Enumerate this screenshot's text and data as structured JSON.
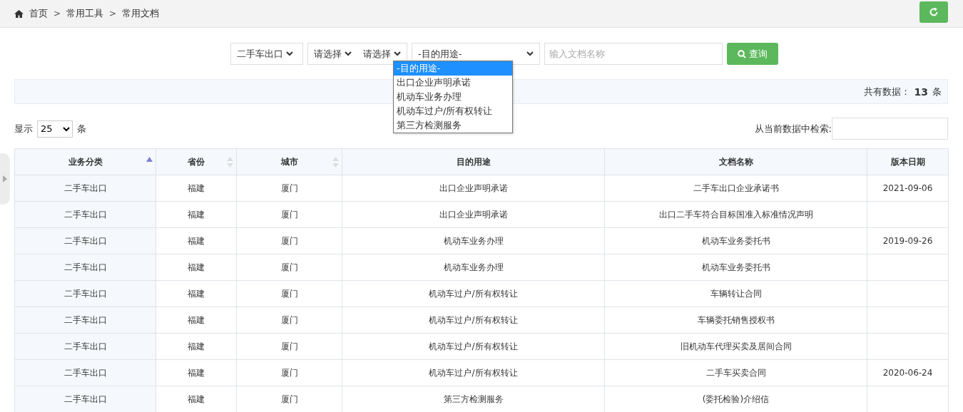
{
  "breadcrumb": [
    "首页",
    "常用工具",
    "常用文档"
  ],
  "breadcrumb_separator": ">",
  "filters": {
    "category": "二手车出口",
    "province": "请选择",
    "city": "请选择",
    "purpose": "-目的用途-",
    "name_placeholder": "输入文档名称",
    "search_button": "查询"
  },
  "purpose_menu": [
    {
      "label": "-目的用途-",
      "selected": true
    },
    {
      "label": "出口企业声明承诺",
      "selected": false
    },
    {
      "label": "机动车业务办理",
      "selected": false
    },
    {
      "label": "机动车过户/所有权转让",
      "selected": false
    },
    {
      "label": "第三方检测服务",
      "selected": false
    }
  ],
  "summary": {
    "label": "共有数据：",
    "count": "13",
    "unit": "条"
  },
  "page_size": {
    "prefix": "显示",
    "value": "25",
    "suffix": "条"
  },
  "filter_label": "从当前数据中检索:",
  "table": {
    "columns": [
      {
        "label": "业务分类",
        "sortable": true,
        "sorted": true
      },
      {
        "label": "省份",
        "sortable": true,
        "sorted": false
      },
      {
        "label": "城市",
        "sortable": true,
        "sorted": false
      },
      {
        "label": "目的用途"
      },
      {
        "label": "文档名称"
      },
      {
        "label": "版本日期"
      }
    ],
    "rows": [
      [
        "二手车出口",
        "福建",
        "厦门",
        "出口企业声明承诺",
        "二手车出口企业承诺书",
        "2021-09-06"
      ],
      [
        "二手车出口",
        "福建",
        "厦门",
        "出口企业声明承诺",
        "出口二手车符合目标国准入标准情况声明",
        ""
      ],
      [
        "二手车出口",
        "福建",
        "厦门",
        "机动车业务办理",
        "机动车业务委托书",
        "2019-09-26"
      ],
      [
        "二手车出口",
        "福建",
        "厦门",
        "机动车业务办理",
        "机动车业务委托书",
        ""
      ],
      [
        "二手车出口",
        "福建",
        "厦门",
        "机动车过户/所有权转让",
        "车辆转让合同",
        ""
      ],
      [
        "二手车出口",
        "福建",
        "厦门",
        "机动车过户/所有权转让",
        "车辆委托销售授权书",
        ""
      ],
      [
        "二手车出口",
        "福建",
        "厦门",
        "机动车过户/所有权转让",
        "旧机动车代理买卖及居间合同",
        ""
      ],
      [
        "二手车出口",
        "福建",
        "厦门",
        "机动车过户/所有权转让",
        "二手车买卖合同",
        "2020-06-24"
      ],
      [
        "二手车出口",
        "福建",
        "厦门",
        "第三方检测服务",
        "(委托检验)介绍信",
        ""
      ]
    ]
  }
}
